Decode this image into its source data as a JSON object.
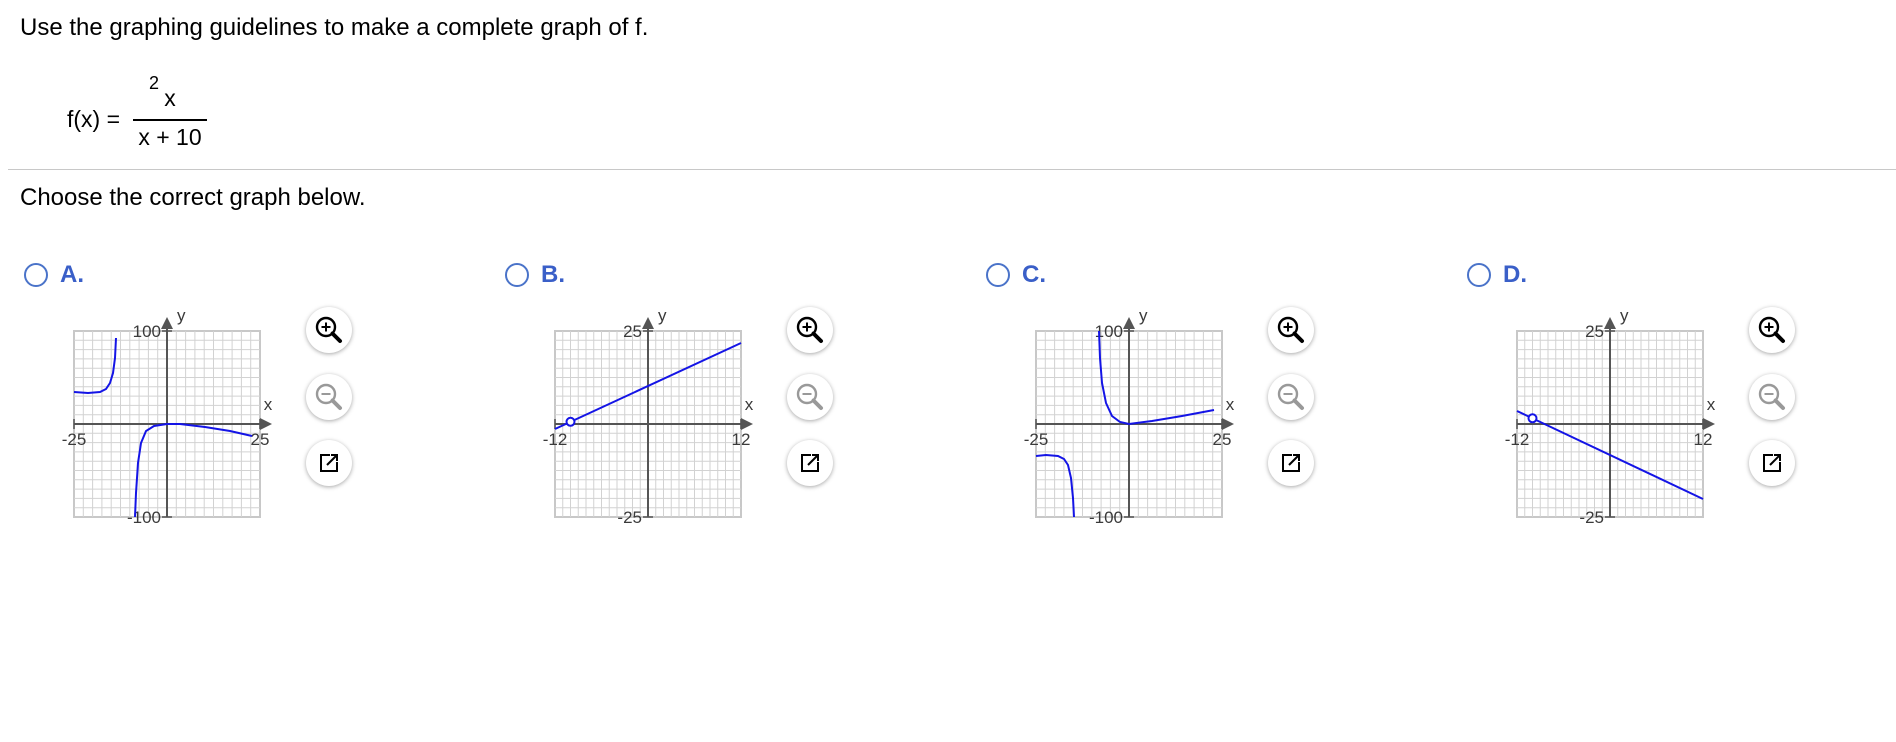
{
  "question": {
    "instruction": "Use the graphing guidelines to make a complete graph of f.",
    "function_label": "f(x) =",
    "numerator_base": "x",
    "numerator_exponent": "2",
    "denominator": "x + 10",
    "prompt": "Choose the correct graph below."
  },
  "options": [
    {
      "letter": "A.",
      "x_axis_label": "x",
      "y_axis_label": "y",
      "x_min_label": "-25",
      "x_max_label": "25",
      "y_max_label": "100",
      "y_min_label": "-100"
    },
    {
      "letter": "B.",
      "x_axis_label": "x",
      "y_axis_label": "y",
      "x_min_label": "-12",
      "x_max_label": "12",
      "y_max_label": "25",
      "y_min_label": "-25"
    },
    {
      "letter": "C.",
      "x_axis_label": "x",
      "y_axis_label": "y",
      "x_min_label": "-25",
      "x_max_label": "25",
      "y_max_label": "100",
      "y_min_label": "-100"
    },
    {
      "letter": "D.",
      "x_axis_label": "x",
      "y_axis_label": "y",
      "x_min_label": "-12",
      "x_max_label": "12",
      "y_max_label": "25",
      "y_min_label": "-25"
    }
  ],
  "tools": {
    "zoom_in_icon": "zoom-in-icon",
    "zoom_out_icon": "zoom-out-icon",
    "popout_icon": "popout-icon"
  },
  "colors": {
    "accent": "#3a5fc8",
    "curve": "#1414e6",
    "grid": "#c8c8c8",
    "axis": "#555555"
  }
}
